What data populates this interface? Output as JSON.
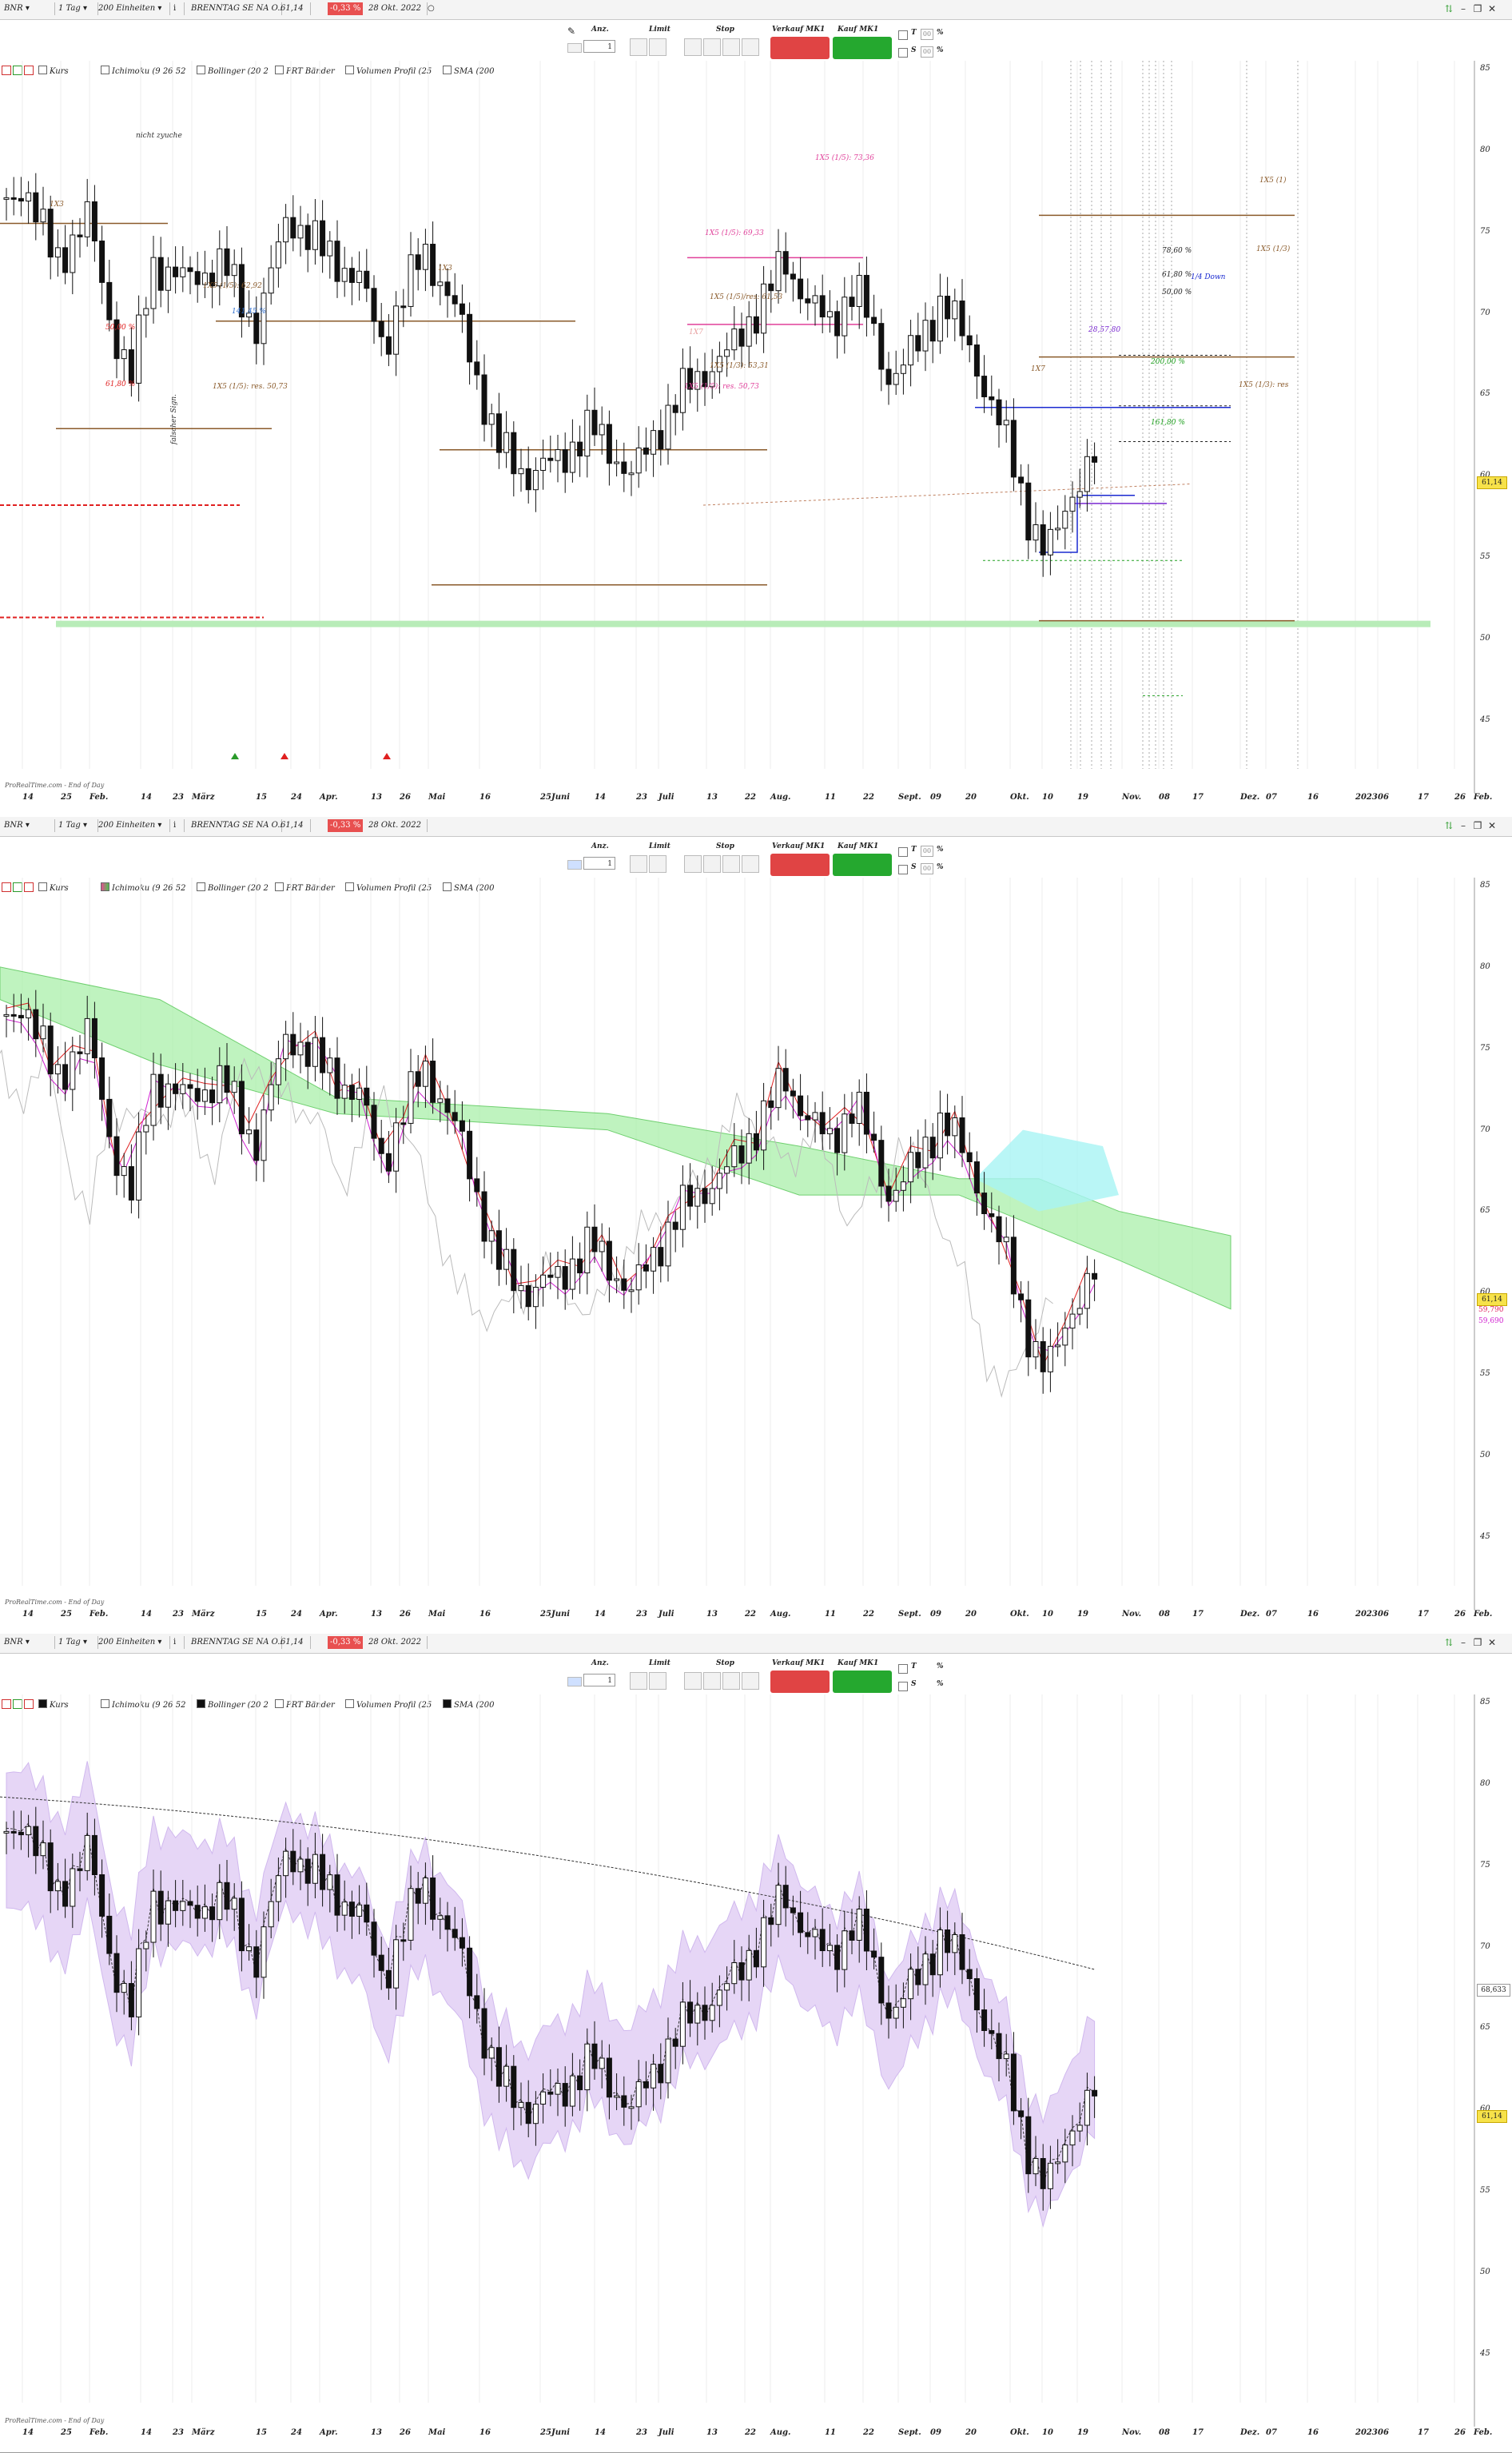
{
  "toolbar": {
    "symbol": "BNR",
    "interval": "1 Tag",
    "units": "200 Einheiten",
    "instrument": "BRENNTAG SE NA O.N.",
    "last_price": "61,14",
    "change": "-0,33 %",
    "date": "28 Okt. 2022"
  },
  "order_panel": {
    "anz_label": "Anz.",
    "limit_label": "Limit",
    "stop_label": "Stop",
    "sell_label": "Verkauf MK1",
    "buy_label": "Kauf MK1",
    "qty_value": "1",
    "t_label": "T",
    "s_label": "S",
    "t_value": "00",
    "s_value": "00",
    "pct_sign": "%"
  },
  "indicators": [
    {
      "label": "Kurs"
    },
    {
      "label": "Ichimoku (9 26 52"
    },
    {
      "label": "Bollinger (20 2"
    },
    {
      "label": "PRT Bänder"
    },
    {
      "label": "Volumen Profil (25"
    },
    {
      "label": "SMA (200"
    }
  ],
  "y_axis": [
    "85",
    "80",
    "75",
    "70",
    "65",
    "60",
    "55",
    "50",
    "45"
  ],
  "x_axis": [
    "14",
    "25",
    "Feb.",
    "14",
    "23",
    "März",
    "15",
    "24",
    "Apr.",
    "13",
    "26",
    "Mai",
    "16",
    "25",
    "Juni",
    "14",
    "23",
    "Juli",
    "13",
    "22",
    "Aug.",
    "11",
    "22",
    "Sept.",
    "09",
    "20",
    "Okt.",
    "10",
    "19",
    "Nov.",
    "08",
    "17",
    "Dez.",
    "07",
    "16",
    "2023",
    "06",
    "17",
    "26",
    "Feb."
  ],
  "credit": "ProRealTime.com - End of Day",
  "panel1": {
    "price_tag": "61,14",
    "annotations": [
      {
        "text": "nicht zyuche",
        "color": "#333"
      },
      {
        "text": "1X3"
      },
      {
        "text": "1X3"
      },
      {
        "text": "1X7"
      },
      {
        "text": "1X7"
      },
      {
        "text": "1X5 (1/5): 73,36",
        "color": "#e0409a"
      },
      {
        "text": "1X5 (1/5): 69,33",
        "color": "#e0409a"
      },
      {
        "text": "1X5 (1/5): 62,92",
        "color": "#8a5a2a"
      },
      {
        "text": "1X5 (1/5)/res: 61,53",
        "color": "#8a5a2a"
      },
      {
        "text": "1X5 (1/3): 53,31",
        "color": "#8a5a2a"
      },
      {
        "text": "1X5 (1/5): res. 50,73",
        "color": "#e0409a"
      },
      {
        "text": "1X5 (1/5): res. 50,73",
        "color": "#8a5a2a"
      },
      {
        "text": "141,45 %",
        "color": "#3070d0"
      },
      {
        "text": "50,00 %",
        "color": "#e02020"
      },
      {
        "text": "61,80 %",
        "color": "#e02020"
      },
      {
        "text": "1X5 (1)",
        "color": "#8a5a2a"
      },
      {
        "text": "1X5 (1/3)",
        "color": "#8a5a2a"
      },
      {
        "text": "1X5 (1/3): res",
        "color": "#8a5a2a"
      },
      {
        "text": "78,60 %",
        "color": "#222"
      },
      {
        "text": "61,80 %",
        "color": "#222"
      },
      {
        "text": "1/4 Down",
        "color": "#1a2ad0"
      },
      {
        "text": "50,00 %",
        "color": "#222"
      },
      {
        "text": "28,57,80",
        "color": "#7a2ad0"
      },
      {
        "text": "200,00 %",
        "color": "#20a020"
      },
      {
        "text": "161,80 %",
        "color": "#20a020"
      },
      {
        "text": "falscher Sign.",
        "color": "#333"
      }
    ]
  },
  "panel2": {
    "price_tag": "61,14",
    "labels": [
      "59,790",
      "59,690"
    ]
  },
  "panel3": {
    "price_tag": "61,14",
    "sma_tag": "68,633"
  },
  "colors": {
    "accent_red": "#e85050",
    "cloud_green": "#90f090",
    "cloud_cyan": "#90f0f0",
    "boll_fill": "#e6d6f6",
    "buy_green": "#25a82f",
    "sell_red": "#e04444"
  }
}
